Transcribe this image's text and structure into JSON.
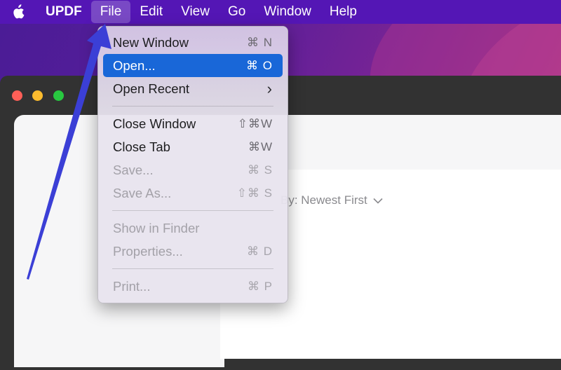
{
  "menubar": {
    "app_name": "UPDF",
    "items": [
      "File",
      "Edit",
      "View",
      "Go",
      "Window",
      "Help"
    ],
    "active": "File"
  },
  "window": {
    "sort_label": "By: Newest First"
  },
  "file_menu": {
    "groups": [
      [
        {
          "label": "New Window",
          "shortcut": "⌘ N",
          "enabled": true
        },
        {
          "label": "Open...",
          "shortcut": "⌘ O",
          "enabled": true,
          "highlighted": true
        },
        {
          "label": "Open Recent",
          "shortcut": "›",
          "enabled": true,
          "submenu": true
        }
      ],
      [
        {
          "label": "Close Window",
          "shortcut": "⇧⌘W",
          "enabled": true
        },
        {
          "label": "Close Tab",
          "shortcut": "⌘W",
          "enabled": true
        },
        {
          "label": "Save...",
          "shortcut": "⌘ S",
          "enabled": false
        },
        {
          "label": "Save As...",
          "shortcut": "⇧⌘ S",
          "enabled": false
        }
      ],
      [
        {
          "label": "Show in Finder",
          "shortcut": "",
          "enabled": false
        },
        {
          "label": "Properties...",
          "shortcut": "⌘ D",
          "enabled": false
        }
      ],
      [
        {
          "label": "Print...",
          "shortcut": "⌘ P",
          "enabled": false
        }
      ]
    ]
  },
  "colors": {
    "menubar": "#5416b5",
    "highlight": "#1967d8",
    "annotation_arrow": "#3b3fd6"
  },
  "icons": {
    "apple": "apple-logo-icon",
    "chevron": "chevron-down-icon",
    "submenu": "chevron-right-icon"
  }
}
